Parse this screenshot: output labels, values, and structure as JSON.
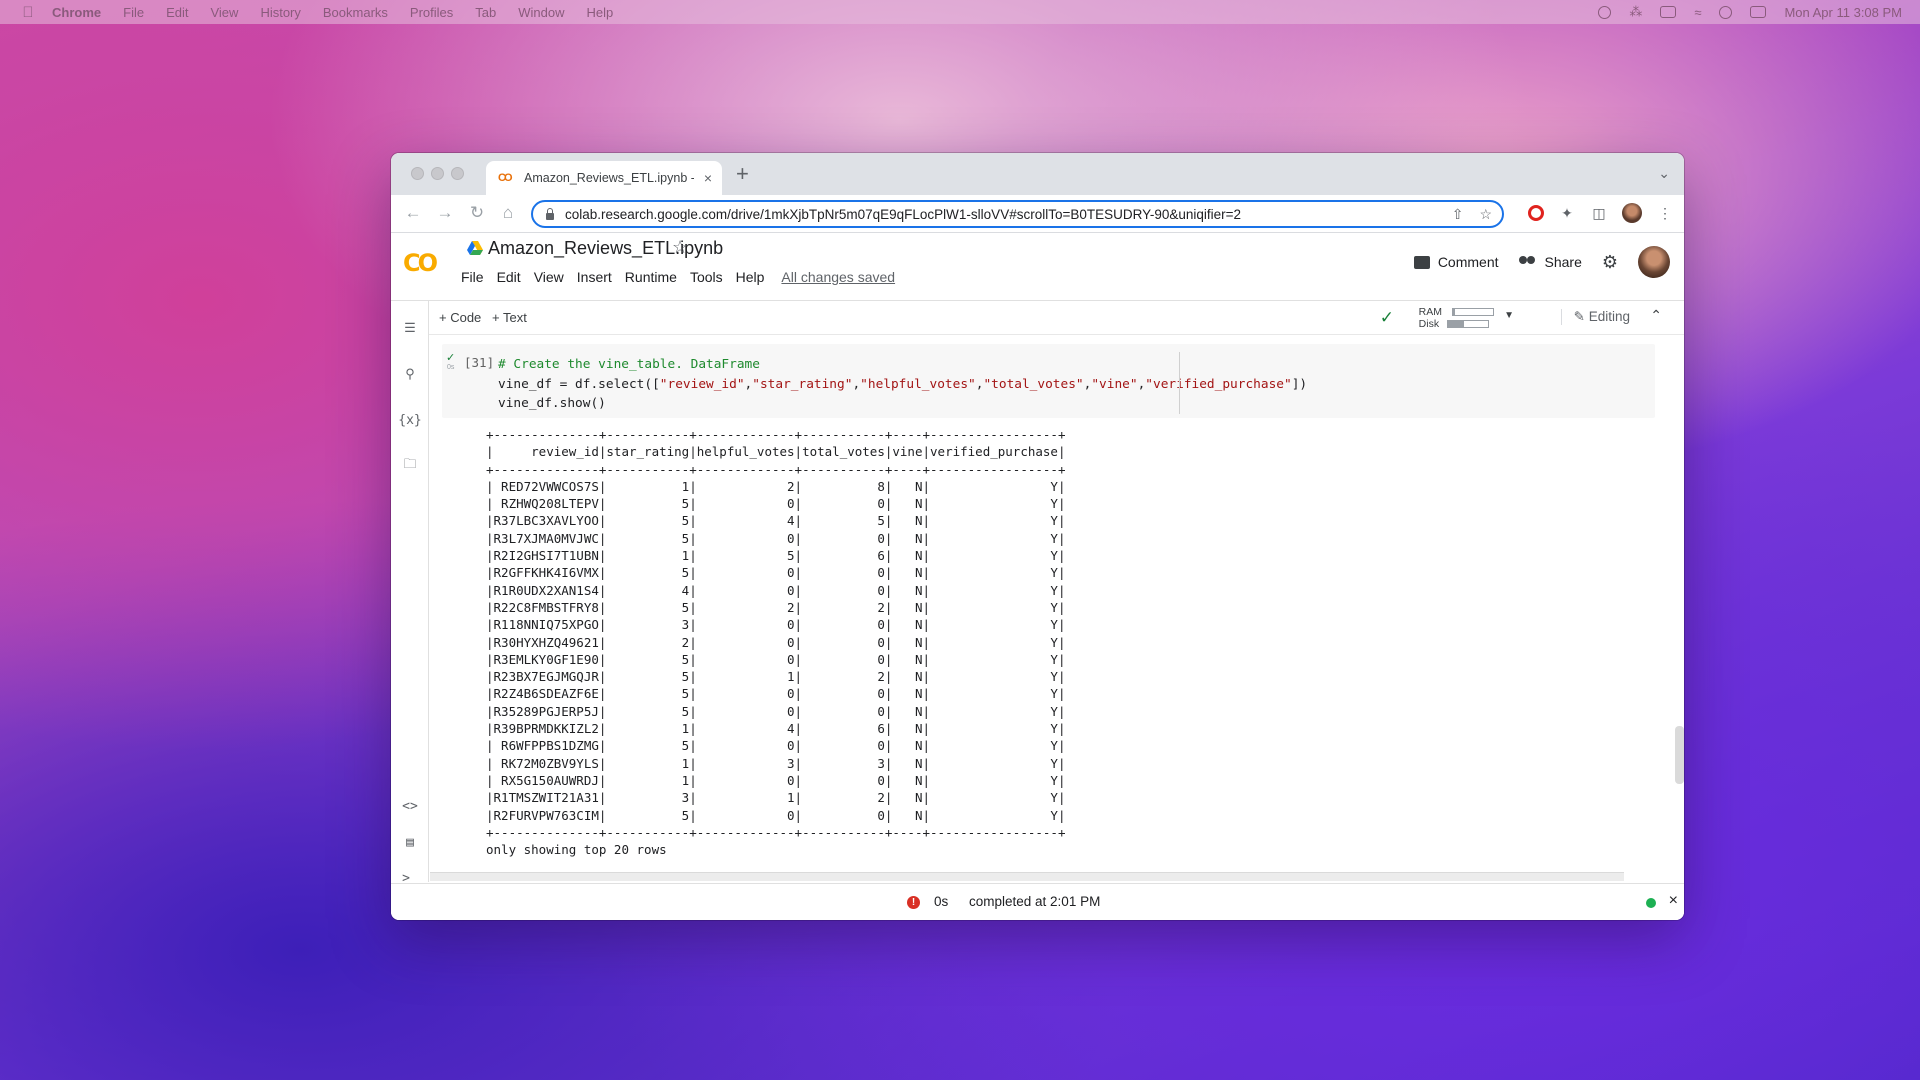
{
  "menubar": {
    "apple_icon": "apple-logo",
    "items": [
      "Chrome",
      "File",
      "Edit",
      "View",
      "History",
      "Bookmarks",
      "Profiles",
      "Tab",
      "Window",
      "Help"
    ],
    "clock": "Mon Apr 11  3:08 PM"
  },
  "browser": {
    "tab_title": "Amazon_Reviews_ETL.ipynb -",
    "tab_close": "×",
    "new_tab": "+",
    "url": "colab.research.google.com/drive/1mkXjbTpNr5m07qE9qFLocPlW1-slloVV#scrollTo=B0TESUDRY-90&uniqifier=2"
  },
  "colab": {
    "logo": "CO",
    "notebook_title": "Amazon_Reviews_ETL.ipynb",
    "menu": [
      "File",
      "Edit",
      "View",
      "Insert",
      "Runtime",
      "Tools",
      "Help"
    ],
    "saved_status": "All changes saved",
    "comment_label": "Comment",
    "share_label": "Share",
    "add_code": "+ Code",
    "add_text": "+ Text",
    "ram_label": "RAM",
    "disk_label": "Disk",
    "ram_usage_fraction": 0.05,
    "disk_usage_fraction": 0.4,
    "editing_label": "Editing"
  },
  "cell": {
    "execution_count": "[31]",
    "run_time": "0s",
    "code_comment": "# Create the vine_table. DataFrame",
    "code_line2_prefix": "vine_df = df.select([",
    "code_columns": [
      "\"review_id\"",
      "\"star_rating\"",
      "\"helpful_votes\"",
      "\"total_votes\"",
      "\"vine\"",
      "\"verified_purchase\""
    ],
    "code_line2_suffix": "])",
    "code_line3": "vine_df.show()",
    "output": {
      "border": "+--------------+-----------+-------------+-----------+----+-----------------+",
      "header": "|     review_id|star_rating|helpful_votes|total_votes|vine|verified_purchase|",
      "rows": [
        "| RED72VWWCOS7S|          1|            2|          8|   N|                Y|",
        "| RZHWQ208LTEPV|          5|            0|          0|   N|                Y|",
        "|R37LBC3XAVLYOO|          5|            4|          5|   N|                Y|",
        "|R3L7XJMA0MVJWC|          5|            0|          0|   N|                Y|",
        "|R2I2GHSI7T1UBN|          1|            5|          6|   N|                Y|",
        "|R2GFFKHK4I6VMX|          5|            0|          0|   N|                Y|",
        "|R1R0UDX2XAN1S4|          4|            0|          0|   N|                Y|",
        "|R22C8FMBSTFRY8|          5|            2|          2|   N|                Y|",
        "|R118NNIQ75XPGO|          3|            0|          0|   N|                Y|",
        "|R30HYXHZQ49621|          2|            0|          0|   N|                Y|",
        "|R3EMLKY0GF1E90|          5|            0|          0|   N|                Y|",
        "|R23BX7EGJMGQJR|          5|            1|          2|   N|                Y|",
        "|R2Z4B6SDEAZF6E|          5|            0|          0|   N|                Y|",
        "|R35289PGJERP5J|          5|            0|          0|   N|                Y|",
        "|R39BPRMDKKIZL2|          1|            4|          6|   N|                Y|",
        "| R6WFPPBS1DZMG|          5|            0|          0|   N|                Y|",
        "| RK72M0ZBV9YLS|          1|            3|          3|   N|                Y|",
        "| RX5G150AUWRDJ|          1|            0|          0|   N|                Y|",
        "|R1TMSZWIT21A31|          3|            1|          2|   N|                Y|",
        "|R2FURVPW763CIM|          5|            0|          0|   N|                Y|"
      ],
      "footer": "only showing top 20 rows"
    }
  },
  "status": {
    "error_mark": "!",
    "elapsed": "0s",
    "completed": "completed at 2:01 PM",
    "close": "×"
  }
}
